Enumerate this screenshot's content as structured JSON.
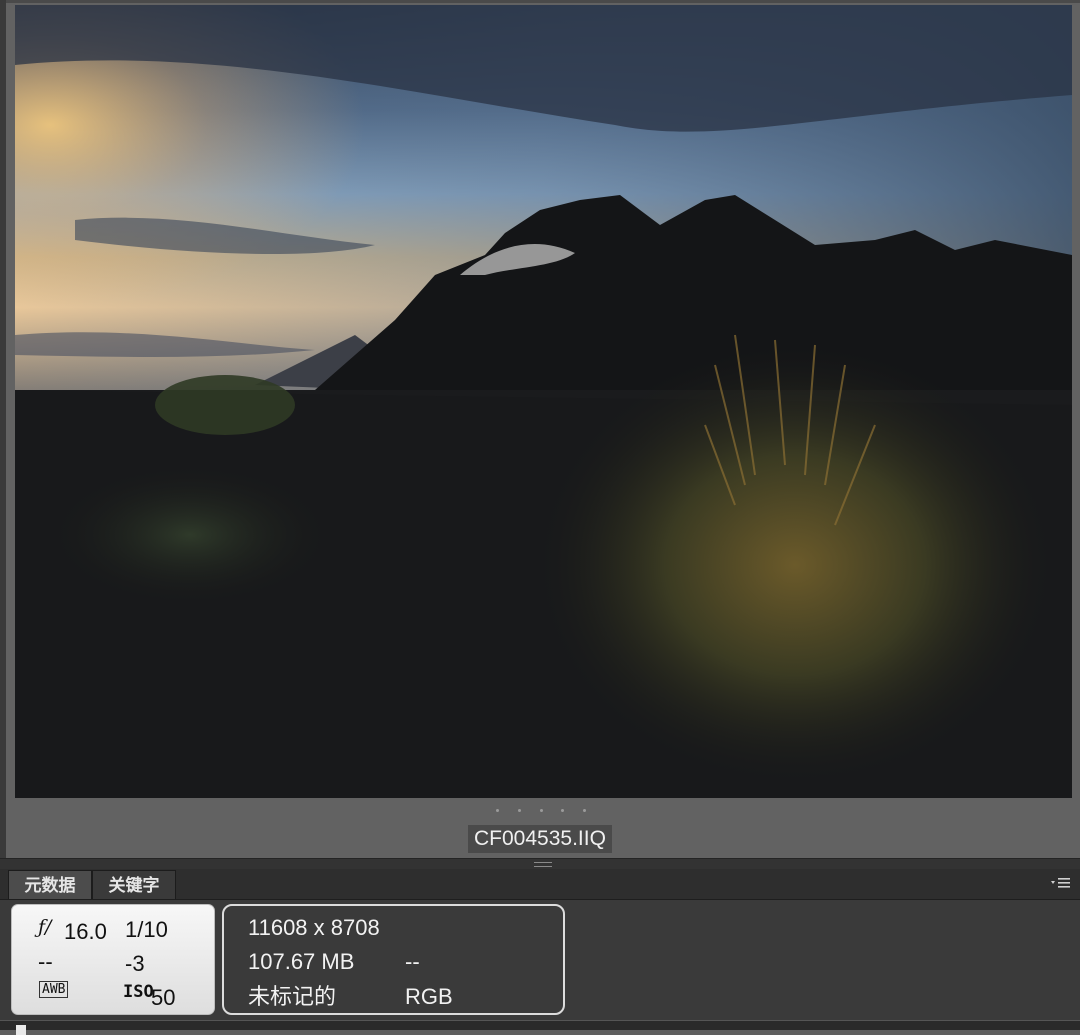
{
  "viewer": {
    "filename": "CF004535.IIQ",
    "photo_description_icon": "landscape-photo"
  },
  "panel": {
    "tabs": [
      {
        "label": "元数据",
        "active": true
      },
      {
        "label": "关键字",
        "active": false
      }
    ],
    "menu_icon": "panel-options-icon",
    "exif": {
      "aperture_symbol": "ƒ/",
      "aperture": "16.0",
      "shutter": "1/10",
      "metering": "--",
      "exposure_comp": "-3",
      "white_balance": "AWB",
      "iso_label": "ISO",
      "iso_value": "50"
    },
    "file_info": {
      "dimensions": "11608 x 8708",
      "file_size": "107.67 MB",
      "extra": "--",
      "label": "未标记的",
      "color_space": "RGB"
    }
  }
}
